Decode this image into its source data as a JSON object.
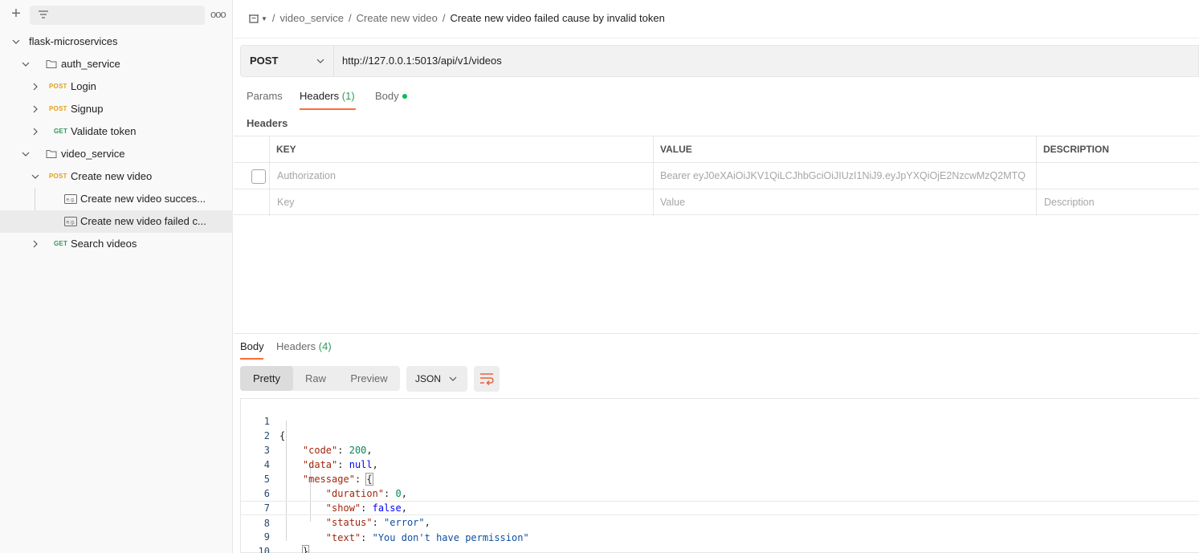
{
  "sidebar": {
    "plus_icon": "plus-icon",
    "filter_icon": "filter-icon",
    "more_label": "ooo",
    "collection": {
      "label": "flask-microservices"
    },
    "folders": [
      {
        "label": "auth_service",
        "requests": [
          {
            "method": "POST",
            "label": "Login"
          },
          {
            "method": "POST",
            "label": "Signup"
          },
          {
            "method": "GET",
            "label": "Validate token"
          }
        ]
      },
      {
        "label": "video_service",
        "requests": [
          {
            "method": "POST",
            "label": "Create new video",
            "examples": [
              {
                "label": "Create new video succes..."
              },
              {
                "label": "Create new video failed c..."
              }
            ]
          },
          {
            "method": "GET",
            "label": "Search videos"
          }
        ]
      }
    ]
  },
  "breadcrumb": {
    "items": [
      "video_service",
      "Create new video"
    ],
    "current": "Create new video failed cause by invalid token",
    "separator": "/"
  },
  "request": {
    "method": "POST",
    "url": "http://127.0.0.1:5013/api/v1/videos",
    "tabs": [
      {
        "label": "Params"
      },
      {
        "label": "Headers",
        "count": "(1)"
      },
      {
        "label": "Body"
      }
    ],
    "section_label": "Headers",
    "table": {
      "columns": [
        "KEY",
        "VALUE",
        "DESCRIPTION"
      ],
      "rows": [
        {
          "key": "Authorization",
          "value": "Bearer eyJ0eXAiOiJKV1QiLCJhbGciOiJIUzI1NiJ9.eyJpYXQiOjE2NzcwMzQ2MTQ",
          "description": ""
        }
      ],
      "placeholder": {
        "key": "Key",
        "value": "Value",
        "description": "Description"
      }
    }
  },
  "response": {
    "tabs": [
      {
        "label": "Body"
      },
      {
        "label": "Headers",
        "count": "(4)"
      }
    ],
    "views": [
      "Pretty",
      "Raw",
      "Preview"
    ],
    "format": "JSON",
    "line_numbers": [
      "1",
      "2",
      "3",
      "4",
      "5",
      "6",
      "7",
      "8",
      "9",
      "10"
    ],
    "json": {
      "code": 200,
      "data": "null",
      "message": {
        "duration": 0,
        "show": "false",
        "status": "\"error\"",
        "text": "\"You don't have permission\""
      }
    }
  },
  "colors": {
    "accent": "#ff6c37",
    "post": "#e0a01b",
    "get": "#2e9a5a",
    "body_dot": "#0cbb52"
  }
}
